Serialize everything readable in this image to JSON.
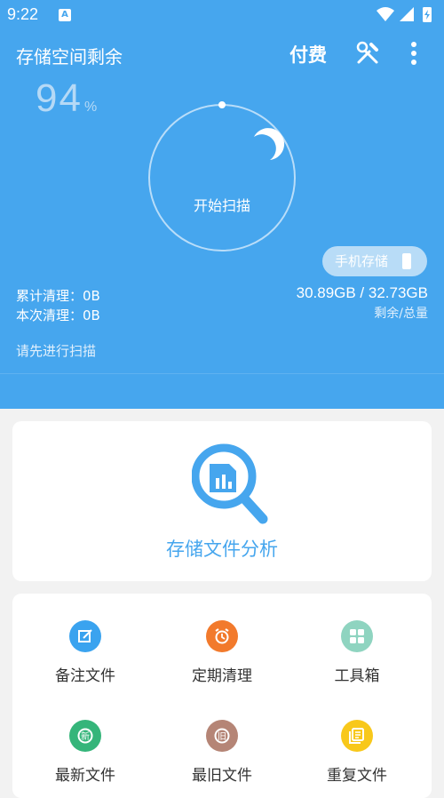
{
  "status_bar": {
    "time": "9:22",
    "notification": "A"
  },
  "header": {
    "title": "存储空间剩余",
    "pay_label": "付费",
    "tools_icon": "tools-icon",
    "more_icon": "more-vert-icon"
  },
  "storage": {
    "percent": "94",
    "percent_unit": "%",
    "scan_button": "开始扫描",
    "storage_selector": "手机存储",
    "size_text": "30.89GB / 32.73GB",
    "size_caption": "剩余/总量",
    "remaining_fraction": 0.94
  },
  "stats": {
    "total_cleaned": "累计清理：0B",
    "this_cleaned": "本次清理：0B",
    "hint": "请先进行扫描"
  },
  "analysis": {
    "label": "存储文件分析",
    "icon": "magnifier-chart-icon"
  },
  "grid": [
    {
      "label": "备注文件",
      "icon": "edit-icon",
      "color": "#3aa3ef"
    },
    {
      "label": "定期清理",
      "icon": "alarm-icon",
      "color": "#f27a2c"
    },
    {
      "label": "工具箱",
      "icon": "apps-icon",
      "color": "#8fd4c0"
    },
    {
      "label": "最新文件",
      "icon": "new-icon",
      "color": "#35b57a"
    },
    {
      "label": "最旧文件",
      "icon": "old-icon",
      "color": "#b58576"
    },
    {
      "label": "重复文件",
      "icon": "duplicate-icon",
      "color": "#f8c81b"
    }
  ],
  "colors": {
    "accent": "#46a6ee",
    "background": "#f2f2f2"
  }
}
